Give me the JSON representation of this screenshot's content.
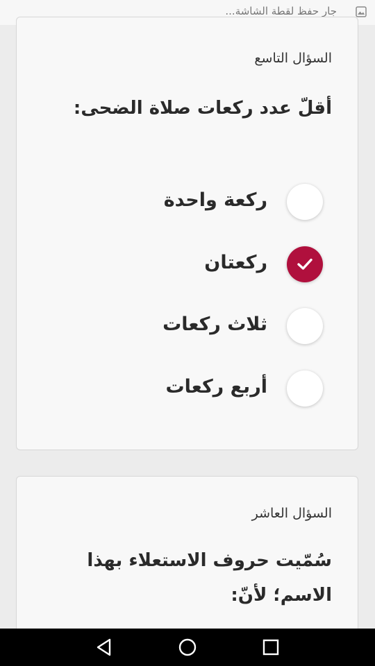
{
  "status_bar": {
    "text": "جارٍ حفظ لقطة الشاشة...",
    "icon": "image-icon"
  },
  "questions": [
    {
      "label": "السؤال التاسع",
      "text": "أقلّ عدد ركعات صلاة الضحى:",
      "options": [
        {
          "label": "ركعة واحدة",
          "selected": false
        },
        {
          "label": "ركعتان",
          "selected": true
        },
        {
          "label": "ثلاث ركعات",
          "selected": false
        },
        {
          "label": "أربع ركعات",
          "selected": false
        }
      ]
    },
    {
      "label": "السؤال العاشر",
      "text_lines": [
        "سُمّيت حروف الاستعلاء بهذا",
        "الاسم؛ لأنّ:"
      ]
    }
  ],
  "colors": {
    "accent": "#b0103d",
    "background": "#ececec",
    "card": "#f8f8f8"
  },
  "nav_bar": {
    "icons": [
      "back-icon",
      "home-icon",
      "recents-icon"
    ]
  }
}
